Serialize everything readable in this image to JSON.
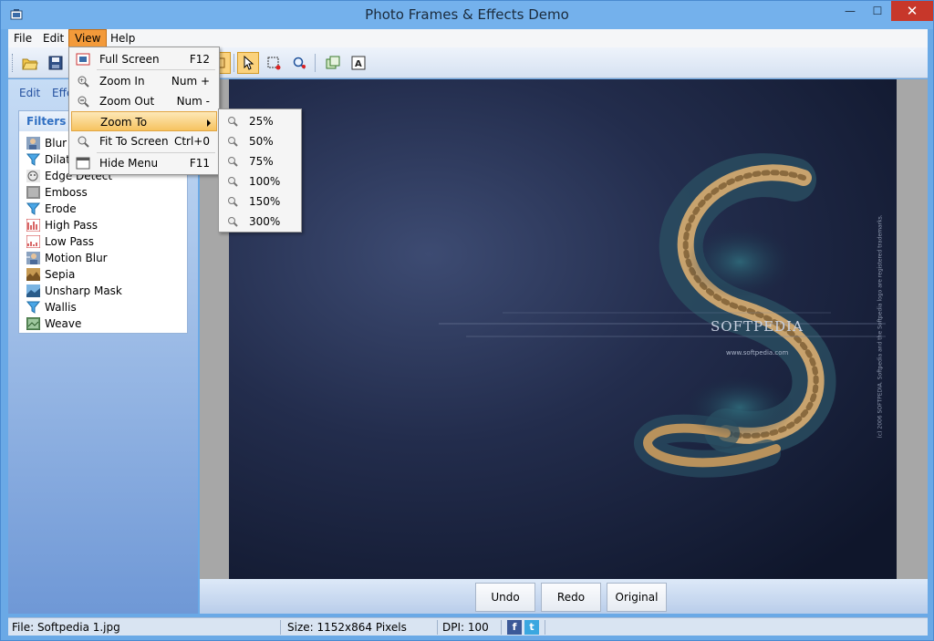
{
  "window": {
    "title": "Photo Frames & Effects Demo",
    "min_glyph": "—",
    "max_glyph": "☐",
    "close_glyph": "✕"
  },
  "menubar": {
    "items": [
      {
        "label": "File"
      },
      {
        "label": "Edit"
      },
      {
        "label": "View"
      },
      {
        "label": "Help"
      }
    ]
  },
  "view_menu": {
    "items": [
      {
        "label": "Full Screen",
        "shortcut": "F12",
        "icon": "fullscreen-icon"
      },
      {
        "label": "Zoom In",
        "shortcut": "Num +",
        "icon": "zoom-in-icon"
      },
      {
        "label": "Zoom Out",
        "shortcut": "Num -",
        "icon": "zoom-out-icon"
      },
      {
        "label": "Zoom To",
        "shortcut": "",
        "icon": "",
        "has_submenu": true
      },
      {
        "label": "Fit To Screen",
        "shortcut": "Ctrl+0",
        "icon": "fit-to-screen-icon"
      },
      {
        "label": "Hide Menu",
        "shortcut": "F11",
        "icon": "hide-menu-icon"
      }
    ]
  },
  "zoom_submenu": {
    "items": [
      {
        "label": "25%"
      },
      {
        "label": "50%"
      },
      {
        "label": "75%"
      },
      {
        "label": "100%"
      },
      {
        "label": "150%"
      },
      {
        "label": "300%"
      }
    ]
  },
  "sidepanel": {
    "tabs": [
      {
        "label": "Edit"
      },
      {
        "label": "Effe"
      }
    ],
    "filters_title": "Filters",
    "filters": [
      {
        "label": "Blur"
      },
      {
        "label": "Dilate"
      },
      {
        "label": "Edge Detect"
      },
      {
        "label": "Emboss"
      },
      {
        "label": "Erode"
      },
      {
        "label": "High Pass"
      },
      {
        "label": "Low Pass"
      },
      {
        "label": "Motion Blur"
      },
      {
        "label": "Sepia"
      },
      {
        "label": "Unsharp Mask"
      },
      {
        "label": "Wallis"
      },
      {
        "label": "Weave"
      }
    ]
  },
  "photo": {
    "watermark": "SOFTPEDIA",
    "url": "www.softpedia.com",
    "side_text": "(c) 2006 SOFTPEDIA. Softpedia and the Softpedia logo are registered trademarks."
  },
  "bottom_buttons": {
    "undo": "Undo",
    "redo": "Redo",
    "original": "Original"
  },
  "statusbar": {
    "file": "File: Softpedia 1.jpg",
    "size": "Size: 1152x864 Pixels",
    "dpi": "DPI: 100",
    "facebook": "f",
    "twitter": "t"
  },
  "colors": {
    "accent": "#f39a3a",
    "title_bar": "#74b1ec",
    "close_button": "#c7372a",
    "filters_title": "#2f6fc2"
  }
}
